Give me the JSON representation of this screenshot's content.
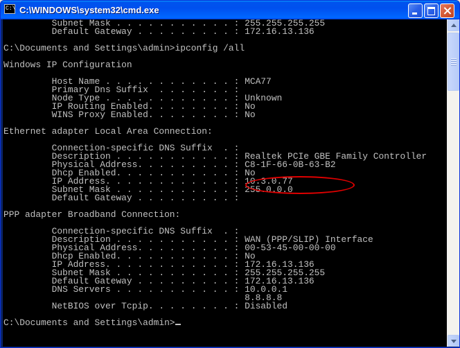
{
  "window": {
    "title": "C:\\WINDOWS\\system32\\cmd.exe",
    "icon_text": "C:\\"
  },
  "console": {
    "lines": [
      "         Subnet Mask . . . . . . . . . . . : 255.255.255.255",
      "         Default Gateway . . . . . . . . . : 172.16.13.136",
      "",
      "C:\\Documents and Settings\\admin>ipconfig /all",
      "",
      "Windows IP Configuration",
      "",
      "         Host Name . . . . . . . . . . . . : MCA77",
      "         Primary Dns Suffix  . . . . . . . :",
      "         Node Type . . . . . . . . . . . . : Unknown",
      "         IP Routing Enabled. . . . . . . . : No",
      "         WINS Proxy Enabled. . . . . . . . : No",
      "",
      "Ethernet adapter Local Area Connection:",
      "",
      "         Connection-specific DNS Suffix  . :",
      "         Description . . . . . . . . . . . : Realtek PCIe GBE Family Controller",
      "         Physical Address. . . . . . . . . : C8-1F-66-0B-63-B2",
      "         Dhcp Enabled. . . . . . . . . . . : No",
      "         IP Address. . . . . . . . . . . . : 10.3.0.77",
      "         Subnet Mask . . . . . . . . . . . : 255.0.0.0",
      "         Default Gateway . . . . . . . . . :",
      "",
      "PPP adapter Broadband Connection:",
      "",
      "         Connection-specific DNS Suffix  . :",
      "         Description . . . . . . . . . . . : WAN (PPP/SLIP) Interface",
      "         Physical Address. . . . . . . . . : 00-53-45-00-00-00",
      "         Dhcp Enabled. . . . . . . . . . . : No",
      "         IP Address. . . . . . . . . . . . : 172.16.13.136",
      "         Subnet Mask . . . . . . . . . . . : 255.255.255.255",
      "         Default Gateway . . . . . . . . . : 172.16.13.136",
      "         DNS Servers . . . . . . . . . . . : 10.0.0.1",
      "                                             8.8.8.8",
      "         NetBIOS over Tcpip. . . . . . . . : Disabled",
      "",
      "C:\\Documents and Settings\\admin>"
    ]
  },
  "annotation": {
    "color": "#e00000",
    "target": "physical-address-value"
  },
  "icons": {
    "minimize": "minimize-icon",
    "maximize": "maximize-icon",
    "close": "close-icon",
    "scroll_up": "scroll-up-arrow-icon",
    "scroll_down": "scroll-down-arrow-icon"
  }
}
